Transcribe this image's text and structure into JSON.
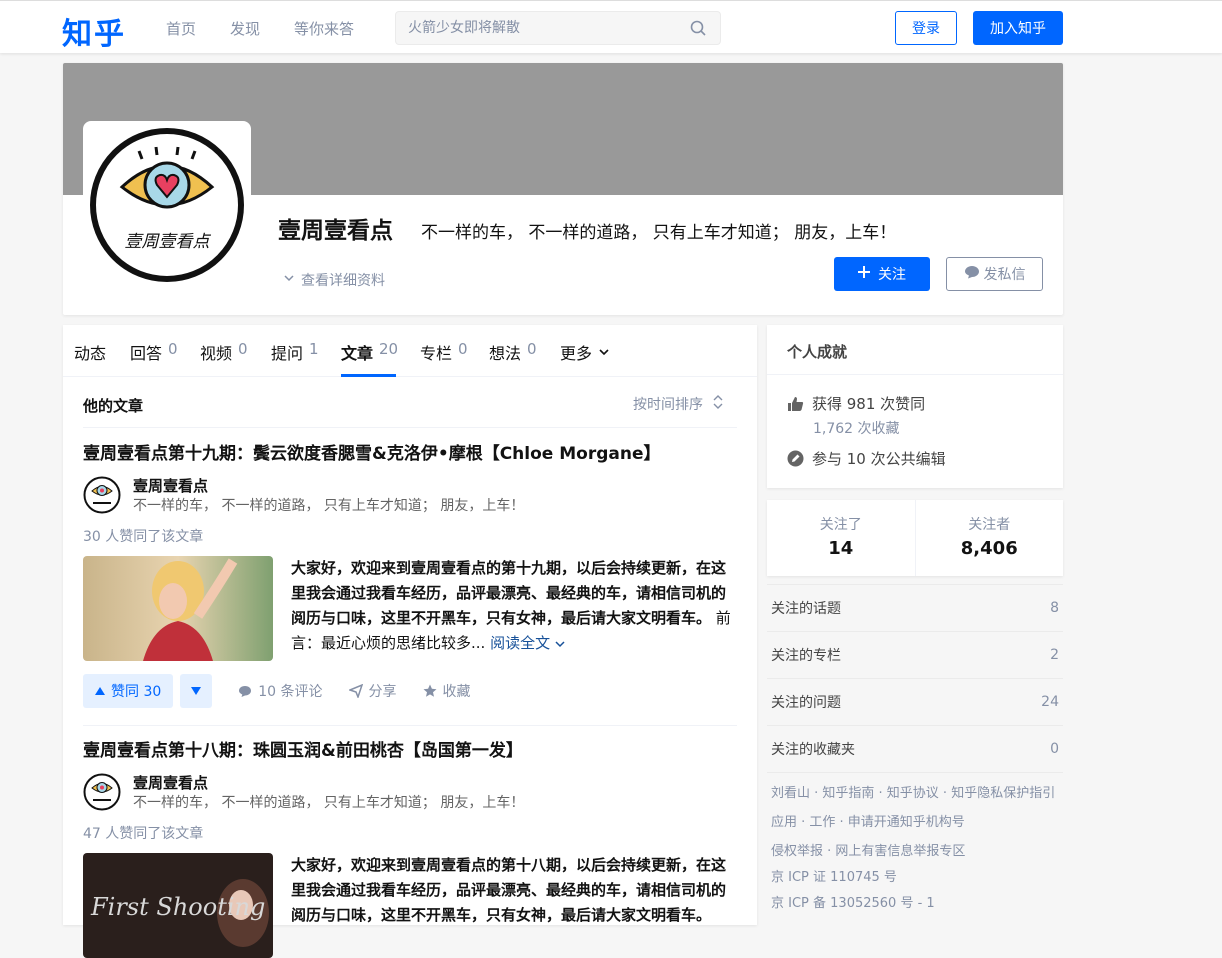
{
  "topbar": {
    "logo": "知乎",
    "nav": [
      "首页",
      "发现",
      "等你来答"
    ],
    "search_placeholder": "火箭少女即将解散",
    "login_label": "登录",
    "join_label": "加入知乎"
  },
  "profile": {
    "avatar_text": "壹周壹看点",
    "name": "壹周壹看点",
    "headline": "不一样的车， 不一样的道路， 只有上车才知道； 朋友，上车！",
    "detail_link": "查看详细资料",
    "follow_label": "关注",
    "message_label": "发私信"
  },
  "tabs": [
    {
      "label": "动态",
      "count": ""
    },
    {
      "label": "回答",
      "count": "0"
    },
    {
      "label": "视频",
      "count": "0"
    },
    {
      "label": "提问",
      "count": "1"
    },
    {
      "label": "文章",
      "count": "20"
    },
    {
      "label": "专栏",
      "count": "0"
    },
    {
      "label": "想法",
      "count": "0"
    },
    {
      "label": "更多",
      "count": ""
    }
  ],
  "list": {
    "heading": "他的文章",
    "sort_label": "按时间排序"
  },
  "articles": [
    {
      "title": "壹周壹看点第十九期：鬓云欲度香腮雪&克洛伊•摩根【Chloe Morgane】",
      "author": "壹周壹看点",
      "author_headline": "不一样的车， 不一样的道路， 只有上车才知道； 朋友，上车！",
      "votes_text": "30 人赞同了该文章",
      "excerpt_bold": "大家好，欢迎来到壹周壹看点的第十九期，以后会持续更新，在这里我会通过我看车经历，品评最漂亮、最经典的车，请相信司机的阅历与口味，这里不开黑车，只有女神，最后请大家文明看车。",
      "excerpt_rest": " 前言：最近心烦的思绪比较多...",
      "read_more": "阅读全文",
      "vote_label": "赞同 30",
      "comments_label": "10 条评论",
      "share_label": "分享",
      "collect_label": "收藏"
    },
    {
      "title": "壹周壹看点第十八期：珠圆玉润&前田桃杏【岛国第一发】",
      "author": "壹周壹看点",
      "author_headline": "不一样的车， 不一样的道路， 只有上车才知道； 朋友，上车！",
      "votes_text": "47 人赞同了该文章",
      "excerpt_bold": "大家好，欢迎来到壹周壹看点的第十八期，以后会持续更新，在这里我会通过我看车经历，品评最漂亮、最经典的车，请相信司机的阅历与口味，这里不开黑车，只有女神，最后请大家文明看车。",
      "thumb_text": "First Shooting"
    }
  ],
  "achievements": {
    "heading": "个人成就",
    "likes": "获得 981 次赞同",
    "collections": "1,762 次收藏",
    "edits": "参与 10 次公共编辑"
  },
  "follow": {
    "following_label": "关注了",
    "following": "14",
    "followers_label": "关注者",
    "followers": "8,406"
  },
  "stats": [
    {
      "label": "关注的话题",
      "value": "8"
    },
    {
      "label": "关注的专栏",
      "value": "2"
    },
    {
      "label": "关注的问题",
      "value": "24"
    },
    {
      "label": "关注的收藏夹",
      "value": "0"
    }
  ],
  "footer": [
    "刘看山 · 知乎指南 · 知乎协议 · 知乎隐私保护指引",
    "应用 · 工作 · 申请开通知乎机构号",
    "侵权举报 · 网上有害信息举报专区",
    "京 ICP 证 110745 号",
    "京 ICP 备 13052560 号 - 1"
  ],
  "colors": {
    "brand": "#0066ff",
    "muted": "#8590a6",
    "link": "#175199"
  }
}
